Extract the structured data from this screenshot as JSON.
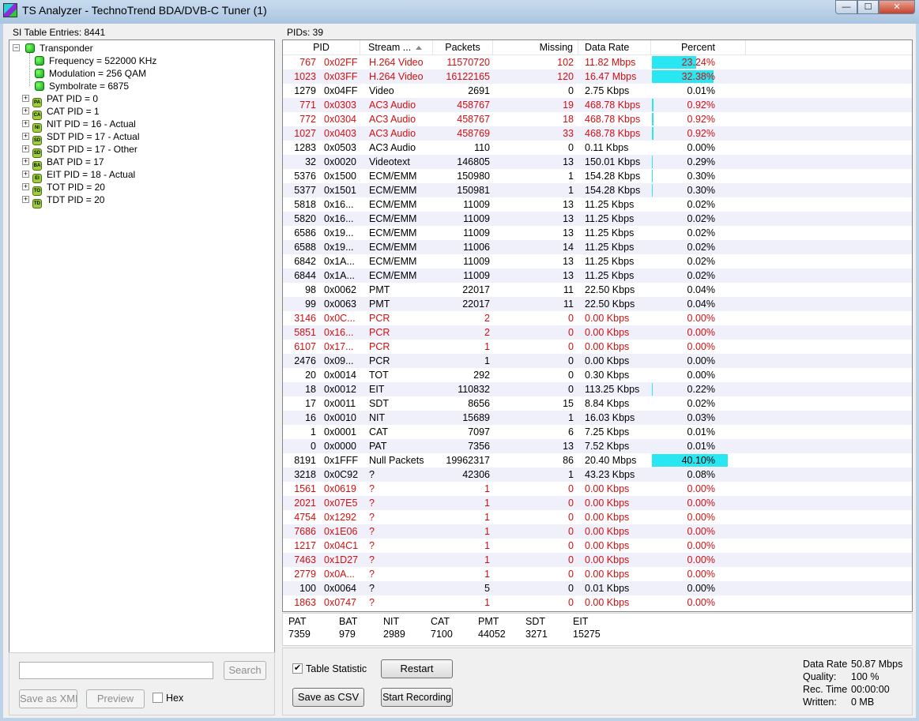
{
  "window": {
    "title": "TS Analyzer - TechnoTrend BDA/DVB-C Tuner (1)",
    "min_glyph": "—",
    "max_glyph": "☐",
    "close_glyph": "✕",
    "icon": "app-icon"
  },
  "left": {
    "header": "SI Table Entries: 8441",
    "tree": {
      "root": "Transponder",
      "children": [
        "Frequency = 522000 KHz",
        "Modulation = 256 QAM",
        "Symbolrate = 6875"
      ],
      "tables": [
        {
          "badge": "PA",
          "label": "PAT PID = 0"
        },
        {
          "badge": "CA",
          "label": "CAT PID = 1"
        },
        {
          "badge": "NI",
          "label": "NIT PID = 16 - Actual"
        },
        {
          "badge": "SD",
          "label": "SDT PID = 17 - Actual"
        },
        {
          "badge": "SD",
          "label": "SDT PID = 17 - Other"
        },
        {
          "badge": "BA",
          "label": "BAT PID = 17"
        },
        {
          "badge": "EI",
          "label": "EIT PID = 18 - Actual"
        },
        {
          "badge": "TO",
          "label": "TOT PID = 20"
        },
        {
          "badge": "TD",
          "label": "TDT PID = 20"
        }
      ],
      "collapse_glyph": "−",
      "expand_glyph": "+"
    },
    "search": {
      "value": "",
      "button": "Search"
    },
    "save_xml": "Save as XML",
    "preview": "Preview",
    "hex": {
      "label": "Hex",
      "checked": false
    }
  },
  "right": {
    "header": "PIDs: 39",
    "columns": [
      "PID",
      "Stream ...",
      "Packets",
      "Missing",
      "Data Rate",
      "Percent"
    ],
    "rows": [
      {
        "pid": "767",
        "hex": "0x02FF",
        "type": "H.264 Video",
        "packets": "11570720",
        "missing": "102",
        "rate": "11.82 Mbps",
        "percent": "23.24%",
        "pct": 23.24,
        "red": true
      },
      {
        "pid": "1023",
        "hex": "0x03FF",
        "type": "H.264 Video",
        "packets": "16122165",
        "missing": "120",
        "rate": "16.47 Mbps",
        "percent": "32.38%",
        "pct": 32.38,
        "red": true
      },
      {
        "pid": "1279",
        "hex": "0x04FF",
        "type": "Video",
        "packets": "2691",
        "missing": "0",
        "rate": "2.75 Kbps",
        "percent": "0.01%",
        "pct": 0.01,
        "red": false
      },
      {
        "pid": "771",
        "hex": "0x0303",
        "type": "AC3 Audio",
        "packets": "458767",
        "missing": "19",
        "rate": "468.78 Kbps",
        "percent": "0.92%",
        "pct": 0.92,
        "red": true
      },
      {
        "pid": "772",
        "hex": "0x0304",
        "type": "AC3 Audio",
        "packets": "458767",
        "missing": "18",
        "rate": "468.78 Kbps",
        "percent": "0.92%",
        "pct": 0.92,
        "red": true
      },
      {
        "pid": "1027",
        "hex": "0x0403",
        "type": "AC3 Audio",
        "packets": "458769",
        "missing": "33",
        "rate": "468.78 Kbps",
        "percent": "0.92%",
        "pct": 0.92,
        "red": true
      },
      {
        "pid": "1283",
        "hex": "0x0503",
        "type": "AC3 Audio",
        "packets": "110",
        "missing": "0",
        "rate": "0.11 Kbps",
        "percent": "0.00%",
        "pct": 0,
        "red": false
      },
      {
        "pid": "32",
        "hex": "0x0020",
        "type": "Videotext",
        "packets": "146805",
        "missing": "13",
        "rate": "150.01 Kbps",
        "percent": "0.29%",
        "pct": 0.29,
        "red": false
      },
      {
        "pid": "5376",
        "hex": "0x1500",
        "type": "ECM/EMM",
        "packets": "150980",
        "missing": "1",
        "rate": "154.28 Kbps",
        "percent": "0.30%",
        "pct": 0.3,
        "red": false
      },
      {
        "pid": "5377",
        "hex": "0x1501",
        "type": "ECM/EMM",
        "packets": "150981",
        "missing": "1",
        "rate": "154.28 Kbps",
        "percent": "0.30%",
        "pct": 0.3,
        "red": false
      },
      {
        "pid": "5818",
        "hex": "0x16...",
        "type": "ECM/EMM",
        "packets": "11009",
        "missing": "13",
        "rate": "11.25 Kbps",
        "percent": "0.02%",
        "pct": 0.02,
        "red": false
      },
      {
        "pid": "5820",
        "hex": "0x16...",
        "type": "ECM/EMM",
        "packets": "11009",
        "missing": "13",
        "rate": "11.25 Kbps",
        "percent": "0.02%",
        "pct": 0.02,
        "red": false
      },
      {
        "pid": "6586",
        "hex": "0x19...",
        "type": "ECM/EMM",
        "packets": "11009",
        "missing": "13",
        "rate": "11.25 Kbps",
        "percent": "0.02%",
        "pct": 0.02,
        "red": false
      },
      {
        "pid": "6588",
        "hex": "0x19...",
        "type": "ECM/EMM",
        "packets": "11006",
        "missing": "14",
        "rate": "11.25 Kbps",
        "percent": "0.02%",
        "pct": 0.02,
        "red": false
      },
      {
        "pid": "6842",
        "hex": "0x1A...",
        "type": "ECM/EMM",
        "packets": "11009",
        "missing": "13",
        "rate": "11.25 Kbps",
        "percent": "0.02%",
        "pct": 0.02,
        "red": false
      },
      {
        "pid": "6844",
        "hex": "0x1A...",
        "type": "ECM/EMM",
        "packets": "11009",
        "missing": "13",
        "rate": "11.25 Kbps",
        "percent": "0.02%",
        "pct": 0.02,
        "red": false
      },
      {
        "pid": "98",
        "hex": "0x0062",
        "type": "PMT",
        "packets": "22017",
        "missing": "11",
        "rate": "22.50 Kbps",
        "percent": "0.04%",
        "pct": 0.04,
        "red": false
      },
      {
        "pid": "99",
        "hex": "0x0063",
        "type": "PMT",
        "packets": "22017",
        "missing": "11",
        "rate": "22.50 Kbps",
        "percent": "0.04%",
        "pct": 0.04,
        "red": false
      },
      {
        "pid": "3146",
        "hex": "0x0C...",
        "type": "PCR",
        "packets": "2",
        "missing": "0",
        "rate": "0.00 Kbps",
        "percent": "0.00%",
        "pct": 0,
        "red": true
      },
      {
        "pid": "5851",
        "hex": "0x16...",
        "type": "PCR",
        "packets": "2",
        "missing": "0",
        "rate": "0.00 Kbps",
        "percent": "0.00%",
        "pct": 0,
        "red": true
      },
      {
        "pid": "6107",
        "hex": "0x17...",
        "type": "PCR",
        "packets": "1",
        "missing": "0",
        "rate": "0.00 Kbps",
        "percent": "0.00%",
        "pct": 0,
        "red": true
      },
      {
        "pid": "2476",
        "hex": "0x09...",
        "type": "PCR",
        "packets": "1",
        "missing": "0",
        "rate": "0.00 Kbps",
        "percent": "0.00%",
        "pct": 0,
        "red": false
      },
      {
        "pid": "20",
        "hex": "0x0014",
        "type": "TOT",
        "packets": "292",
        "missing": "0",
        "rate": "0.30 Kbps",
        "percent": "0.00%",
        "pct": 0,
        "red": false
      },
      {
        "pid": "18",
        "hex": "0x0012",
        "type": "EIT",
        "packets": "110832",
        "missing": "0",
        "rate": "113.25 Kbps",
        "percent": "0.22%",
        "pct": 0.22,
        "red": false
      },
      {
        "pid": "17",
        "hex": "0x0011",
        "type": "SDT",
        "packets": "8656",
        "missing": "15",
        "rate": "8.84 Kbps",
        "percent": "0.02%",
        "pct": 0.02,
        "red": false
      },
      {
        "pid": "16",
        "hex": "0x0010",
        "type": "NIT",
        "packets": "15689",
        "missing": "1",
        "rate": "16.03 Kbps",
        "percent": "0.03%",
        "pct": 0.03,
        "red": false
      },
      {
        "pid": "1",
        "hex": "0x0001",
        "type": "CAT",
        "packets": "7097",
        "missing": "6",
        "rate": "7.25 Kbps",
        "percent": "0.01%",
        "pct": 0.01,
        "red": false
      },
      {
        "pid": "0",
        "hex": "0x0000",
        "type": "PAT",
        "packets": "7356",
        "missing": "13",
        "rate": "7.52 Kbps",
        "percent": "0.01%",
        "pct": 0.01,
        "red": false
      },
      {
        "pid": "8191",
        "hex": "0x1FFF",
        "type": "Null Packets",
        "packets": "19962317",
        "missing": "86",
        "rate": "20.40 Mbps",
        "percent": "40.10%",
        "pct": 40.1,
        "red": false
      },
      {
        "pid": "3218",
        "hex": "0x0C92",
        "type": "?",
        "packets": "42306",
        "missing": "1",
        "rate": "43.23 Kbps",
        "percent": "0.08%",
        "pct": 0.08,
        "red": false
      },
      {
        "pid": "1561",
        "hex": "0x0619",
        "type": "?",
        "packets": "1",
        "missing": "0",
        "rate": "0.00 Kbps",
        "percent": "0.00%",
        "pct": 0,
        "red": true
      },
      {
        "pid": "2021",
        "hex": "0x07E5",
        "type": "?",
        "packets": "1",
        "missing": "0",
        "rate": "0.00 Kbps",
        "percent": "0.00%",
        "pct": 0,
        "red": true
      },
      {
        "pid": "4754",
        "hex": "0x1292",
        "type": "?",
        "packets": "1",
        "missing": "0",
        "rate": "0.00 Kbps",
        "percent": "0.00%",
        "pct": 0,
        "red": true
      },
      {
        "pid": "7686",
        "hex": "0x1E06",
        "type": "?",
        "packets": "1",
        "missing": "0",
        "rate": "0.00 Kbps",
        "percent": "0.00%",
        "pct": 0,
        "red": true
      },
      {
        "pid": "1217",
        "hex": "0x04C1",
        "type": "?",
        "packets": "1",
        "missing": "0",
        "rate": "0.00 Kbps",
        "percent": "0.00%",
        "pct": 0,
        "red": true
      },
      {
        "pid": "7463",
        "hex": "0x1D27",
        "type": "?",
        "packets": "1",
        "missing": "0",
        "rate": "0.00 Kbps",
        "percent": "0.00%",
        "pct": 0,
        "red": true
      },
      {
        "pid": "2779",
        "hex": "0x0A...",
        "type": "?",
        "packets": "1",
        "missing": "0",
        "rate": "0.00 Kbps",
        "percent": "0.00%",
        "pct": 0,
        "red": true
      },
      {
        "pid": "100",
        "hex": "0x0064",
        "type": "?",
        "packets": "5",
        "missing": "0",
        "rate": "0.01 Kbps",
        "percent": "0.00%",
        "pct": 0,
        "red": false
      },
      {
        "pid": "1863",
        "hex": "0x0747",
        "type": "?",
        "packets": "1",
        "missing": "0",
        "rate": "0.00 Kbps",
        "percent": "0.00%",
        "pct": 0,
        "red": true
      }
    ],
    "summary": [
      {
        "label": "PAT",
        "value": "7359"
      },
      {
        "label": "BAT",
        "value": "979"
      },
      {
        "label": "NIT",
        "value": "2989"
      },
      {
        "label": "CAT",
        "value": "7100"
      },
      {
        "label": "PMT",
        "value": "44052"
      },
      {
        "label": "SDT",
        "value": "3271"
      },
      {
        "label": "EIT",
        "value": "15275"
      }
    ],
    "table_statistics": {
      "label": "Table Statistic",
      "checked": true
    },
    "restart": "Restart",
    "save_csv": "Save as CSV",
    "start_recording": "Start Recording",
    "status": {
      "data_rate_label": "Data Rate",
      "data_rate": "50.87 Mbps",
      "quality_label": "Quality:",
      "quality": "100 %",
      "rec_time_label": "Rec. Time",
      "rec_time": "00:00:00",
      "written_label": "Written:",
      "written": "0 MB"
    }
  },
  "colors": {
    "bar": "#28e7f2",
    "error_text": "#d10f0f",
    "alt_row": "#f0f0fb"
  }
}
